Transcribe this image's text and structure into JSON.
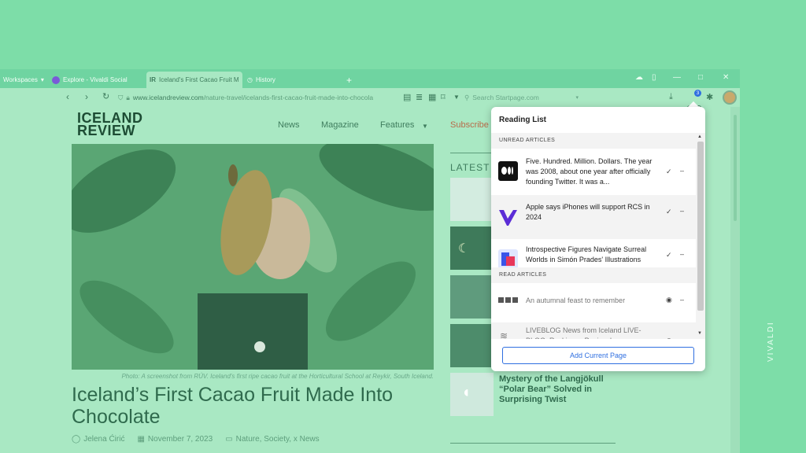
{
  "tabs": [
    {
      "label": "Workspaces"
    },
    {
      "label": "Explore - Vivaldi Social"
    },
    {
      "label": "Iceland's First Cacao Fruit M"
    },
    {
      "label": "History"
    }
  ],
  "address": {
    "domain": "www.icelandreview.com",
    "path": "/nature-travel/icelands-first-cacao-fruit-made-into-chocola",
    "search_placeholder": "Search Startpage.com"
  },
  "reading_list_badge": "3",
  "site": {
    "logo_line1": "ICELAND",
    "logo_line2": "REVIEW",
    "menu": [
      "News",
      "Magazine",
      "Features",
      "Subscribe"
    ]
  },
  "article": {
    "caption": "Photo: A screenshot from RÚV. Iceland's first ripe cacao fruit at the Horticultural School at Reykir, South Iceland.",
    "headline": "Iceland’s First Cacao Fruit Made Into Chocolate",
    "author": "Jelena Ćirić",
    "date": "November 7, 2023",
    "categories": "Nature, Society, x News"
  },
  "sidebar": {
    "section_label": "LATEST",
    "story_title": "Mystery of the Langjökull “Polar Bear” Solved in Surprising Twist"
  },
  "brand_vertical": "VIVALDI",
  "reading_list": {
    "title": "Reading List",
    "unread_heading": "UNREAD ARTICLES",
    "read_heading": "READ ARTICLES",
    "unread": [
      {
        "text": "Five. Hundred. Million. Dollars. The year was 2008, about one year after officially founding Twitter. It was a...",
        "favicon": "medium-icon"
      },
      {
        "text": "Apple says iPhones will support RCS in 2024",
        "favicon": "verge-icon"
      },
      {
        "text": "Introspective Figures Navigate Surreal Worlds in Simón Prades' Illustrations",
        "favicon": "colossal-icon"
      }
    ],
    "read": [
      {
        "text": "An autumnal feast to remember",
        "favicon": "blocks-icon"
      },
      {
        "text": "LIVEBLOG News from Iceland LIVE-BLOG: Reykjanes Peninsula...",
        "favicon": "wave-icon"
      }
    ],
    "add_label": "Add Current Page"
  },
  "colors": {
    "accent": "#2f6fe0",
    "overlay": "#7ddda8"
  }
}
